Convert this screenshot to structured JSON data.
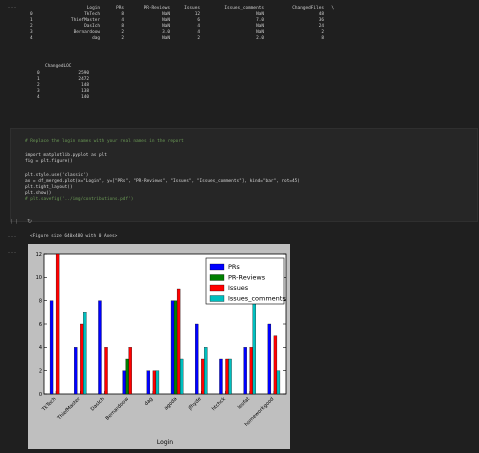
{
  "cell_ellipsis": "...",
  "df_header": [
    "",
    "Login",
    "PRs",
    "PR-Reviews",
    "Issues",
    "Issues_comments",
    "ChangedFiles",
    "\\"
  ],
  "df_rows": [
    [
      "0",
      "TkTech",
      "8",
      "NaN",
      "12",
      "NaN",
      "48"
    ],
    [
      "1",
      "ThiefMaster",
      "4",
      "NaN",
      "6",
      "7.0",
      "36"
    ],
    [
      "2",
      "DasIch",
      "8",
      "NaN",
      "4",
      "NaN",
      "24"
    ],
    [
      "3",
      "Bernardoow",
      "2",
      "3.0",
      "4",
      "NaN",
      "2"
    ],
    [
      "4",
      "dag",
      "2",
      "NaN",
      "2",
      "2.0",
      "8"
    ]
  ],
  "df2_header": "ChangedLOC",
  "df2_rows": [
    [
      "0",
      "2590"
    ],
    [
      "1",
      "2472"
    ],
    [
      "2",
      "148"
    ],
    [
      "3",
      "138"
    ],
    [
      "4",
      "140"
    ]
  ],
  "code": {
    "comment1": "# Replace the login names with your real names in the report",
    "line_import": "import matplotlib.pyplot as plt",
    "line_fig": "fig = plt.figure()",
    "line_style": "plt.style.use('classic')",
    "line_ax": "ax = df_merged.plot(x=\"Login\", y=[\"PRs\", \"PR-Reviews\", \"Issues\", \"Issues_comments\"], kind=\"bar\", rot=45)",
    "line_tight": "plt.tight_layout()",
    "line_show": "plt.show()",
    "line_save": "# plt.savefig('../img/contributions.pdf')",
    "exec_count": "[ ]",
    "exec_icon": "↻"
  },
  "output_text": "<Figure size 640x480 with 0 Axes>",
  "colors": {
    "PRs": "#0000ff",
    "PR-Reviews": "#007f00",
    "Issues": "#ff0000",
    "Issues_comments": "#00bfbf"
  },
  "chart_data": {
    "type": "bar",
    "categories": [
      "TkTech",
      "ThiefMaster",
      "DasIch",
      "Bernardoow",
      "dag",
      "agoda",
      "jfhyde",
      "htchck",
      "leofat",
      "homeworkgood"
    ],
    "series": [
      {
        "name": "PRs",
        "values": [
          8,
          4,
          8,
          2,
          2,
          8,
          6,
          3,
          4,
          6
        ]
      },
      {
        "name": "PR-Reviews",
        "values": [
          0,
          0,
          0,
          3,
          0,
          8,
          0,
          0,
          0,
          0
        ]
      },
      {
        "name": "Issues",
        "values": [
          12,
          6,
          4,
          4,
          2,
          9,
          3,
          3,
          4,
          5
        ]
      },
      {
        "name": "Issues_comments",
        "values": [
          0,
          7,
          0,
          0,
          2,
          3,
          4,
          3,
          9,
          2
        ]
      }
    ],
    "xlabel": "Login",
    "ylabel": "",
    "ylim": [
      0,
      12
    ],
    "yticks": [
      0,
      2,
      4,
      6,
      8,
      10,
      12
    ],
    "legend_position": "top-right",
    "grid": false
  }
}
